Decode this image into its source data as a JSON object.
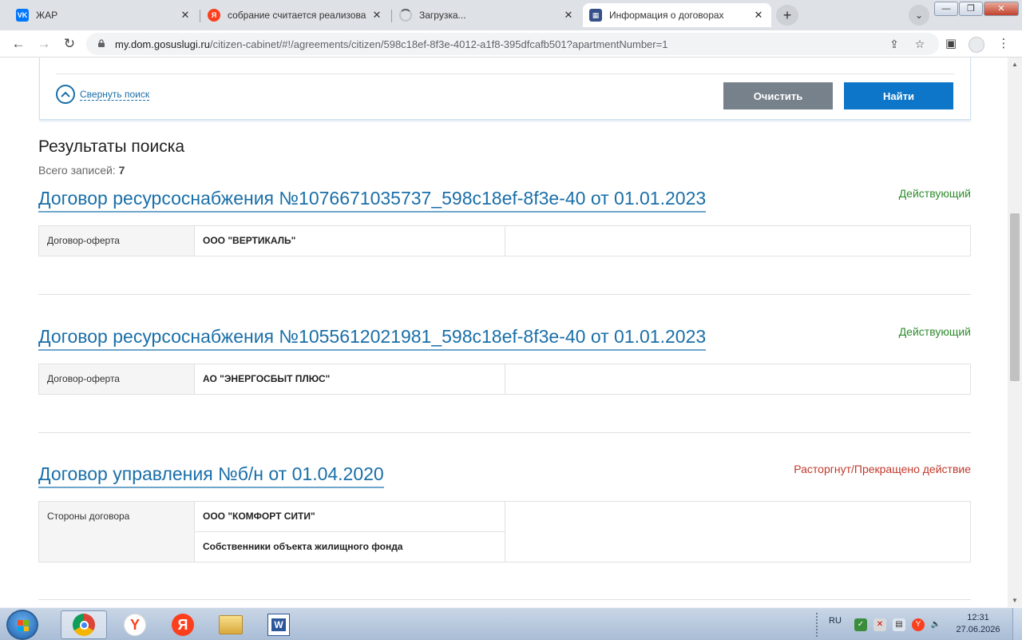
{
  "browser": {
    "tabs": [
      {
        "title": "ЖАР",
        "favicon": "vk-icon",
        "color": "#0077ff",
        "glyph": "VK"
      },
      {
        "title": "собрание считается реализова",
        "favicon": "yandex-icon",
        "color": "#fc3f1d",
        "glyph": "Я"
      },
      {
        "title": "Загрузка...",
        "favicon": "loading-icon",
        "color": "#c0c4ca",
        "glyph": ""
      },
      {
        "title": "Информация о договорах",
        "favicon": "document-icon",
        "color": "#35508a",
        "glyph": "▦"
      }
    ],
    "url_host": "my.dom.gosuslugi.ru",
    "url_path": "/citizen-cabinet/#!/agreements/citizen/598c18ef-8f3e-4012-a1f8-395dfcafb501?apartmentNumber=1"
  },
  "search": {
    "collapse_label": "Свернуть поиск",
    "clear_label": "Очистить",
    "find_label": "Найти"
  },
  "results": {
    "title": "Результаты поиска",
    "count_label": "Всего записей:",
    "count": "7"
  },
  "contracts": [
    {
      "title": "Договор ресурсоснабжения №1076671035737_598c18ef-8f3e-40 от 01.01.2023",
      "status": "Действующий",
      "status_color": "#2e8b2e",
      "type": "Договор-оферта",
      "parties": [
        "ООО \"ВЕРТИКАЛЬ\""
      ]
    },
    {
      "title": "Договор ресурсоснабжения №1055612021981_598c18ef-8f3e-40 от 01.01.2023",
      "status": "Действующий",
      "status_color": "#2e8b2e",
      "type": "Договор-оферта",
      "parties": [
        "АО \"ЭНЕРГОСБЫТ ПЛЮС\""
      ]
    },
    {
      "title": "Договор управления №б/н от 01.04.2020",
      "status": "Расторгнут/Прекращено действие",
      "status_color": "#c0392b",
      "type": "Стороны договора",
      "parties": [
        "ООО \"КОМФОРТ СИТИ\"",
        "Собственники объекта жилищного фонда"
      ]
    }
  ],
  "taskbar": {
    "lang": "RU",
    "time": "12:31",
    "date": "27.06.2026"
  }
}
